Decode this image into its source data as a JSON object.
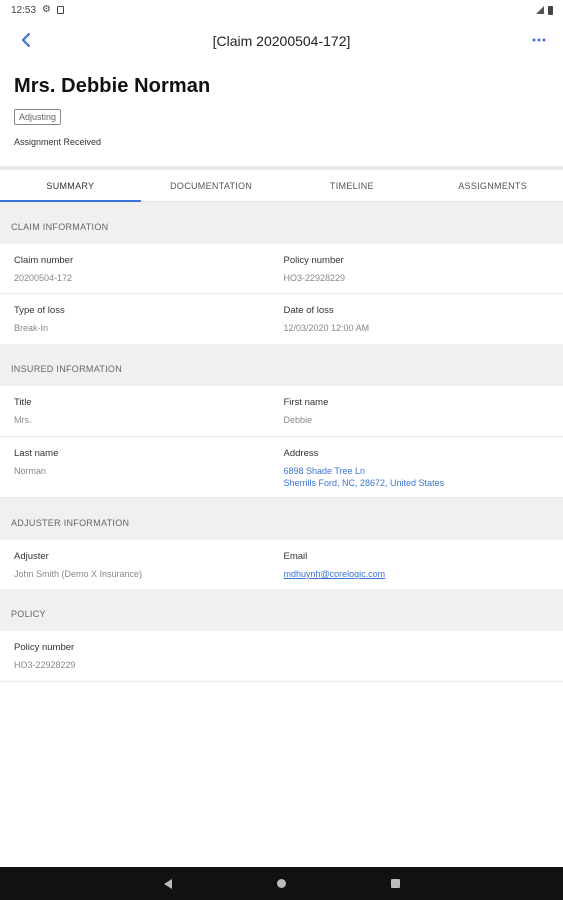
{
  "status_bar": {
    "time": "12:53"
  },
  "app_bar": {
    "title": "[Claim 20200504-172]"
  },
  "header": {
    "name": "Mrs. Debbie Norman",
    "chip": "Adjusting",
    "status": "Assignment Received"
  },
  "tabs": [
    {
      "label": "SUMMARY",
      "active": true
    },
    {
      "label": "DOCUMENTATION",
      "active": false
    },
    {
      "label": "TIMELINE",
      "active": false
    },
    {
      "label": "ASSIGNMENTS",
      "active": false
    }
  ],
  "claim_info": {
    "heading": "CLAIM INFORMATION",
    "claim_number_label": "Claim number",
    "claim_number": "20200504-172",
    "policy_number_label": "Policy number",
    "policy_number": "HO3-22928229",
    "type_of_loss_label": "Type of loss",
    "type_of_loss": "Break-In",
    "date_of_loss_label": "Date of loss",
    "date_of_loss": "12/03/2020 12:00 AM"
  },
  "insured_info": {
    "heading": "INSURED INFORMATION",
    "title_label": "Title",
    "title": "Mrs.",
    "first_name_label": "First name",
    "first_name": "Debbie",
    "last_name_label": "Last name",
    "last_name": "Norman",
    "address_label": "Address",
    "address_line1": "6898 Shade Tree Ln",
    "address_line2": "Sherrills Ford, NC, 28672, United States"
  },
  "adjuster_info": {
    "heading": "ADJUSTER INFORMATION",
    "adjuster_label": "Adjuster",
    "adjuster": "John Smith (Demo X Insurance)",
    "email_label": "Email",
    "email": "mdhuynh@corelogic.com"
  },
  "policy": {
    "heading": "POLICY",
    "policy_number_label": "Policy number",
    "policy_number": "HO3-22928229"
  },
  "colors": {
    "accent": "#3b73d6",
    "section_bg": "#f0f0f0",
    "nav_bar": "#111111"
  }
}
